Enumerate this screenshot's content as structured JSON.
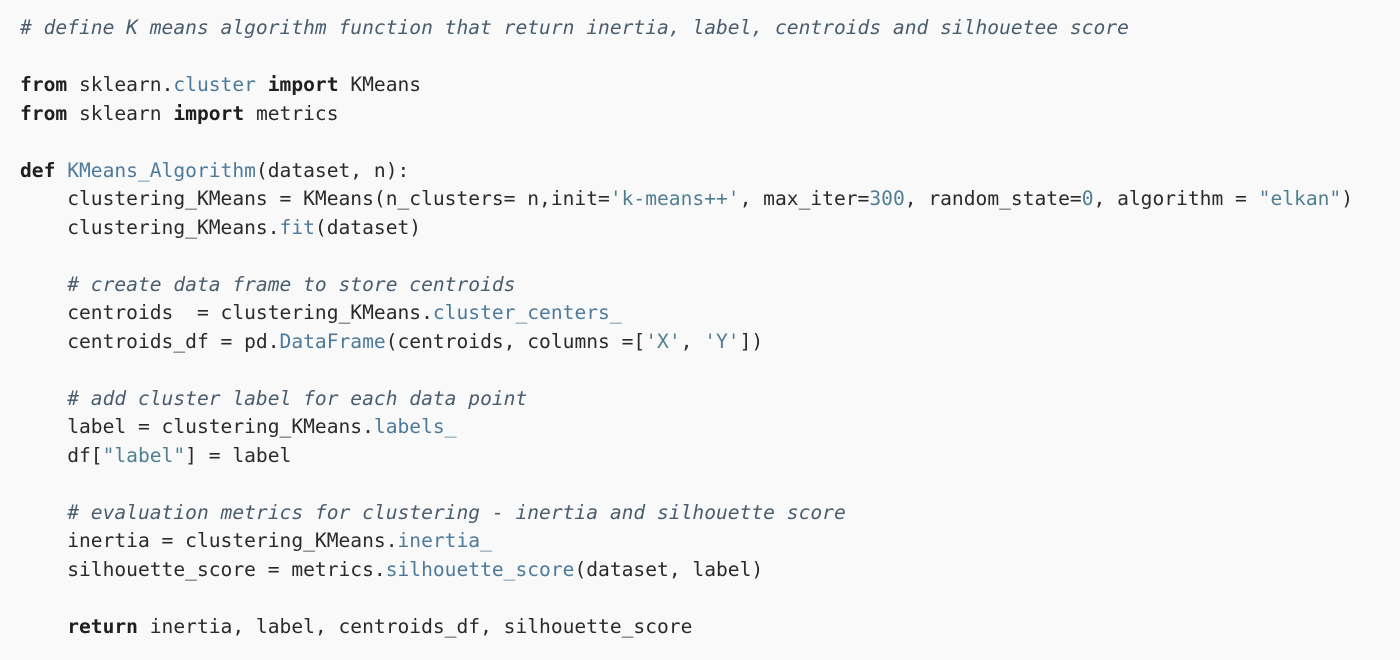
{
  "comment_header": "# define K means algorithm function that return inertia, label, centroids and silhouetee score",
  "import1": {
    "kw_from": "from",
    "module": "sklearn",
    "dot": ".",
    "submodule": "cluster",
    "kw_import": "import",
    "name": "KMeans"
  },
  "import2": {
    "kw_from": "from",
    "module": "sklearn",
    "kw_import": "import",
    "name": "metrics"
  },
  "def_line": {
    "kw_def": "def",
    "func_name": "KMeans_Algorithm",
    "params": "(dataset, n):"
  },
  "kmeans_line": {
    "lhs": "clustering_KMeans = KMeans(n_clusters= n,init=",
    "init_value": "'k-means++'",
    "mid": ", max_iter=",
    "max_iter": "300",
    "mid2": ", random_state=",
    "random_state": "0",
    "mid3": ", algorithm = ",
    "algorithm_value": "\"elkan\"",
    "end": ")"
  },
  "fit_line": {
    "obj": "clustering_KMeans.",
    "method": "fit",
    "args": "(dataset)"
  },
  "comment_centroids": "# create data frame to store centroids",
  "centroids_line": {
    "lhs": "centroids  = clustering_KMeans.",
    "attr": "cluster_centers_"
  },
  "centroids_df_line": {
    "lhs": "centroids_df = pd.",
    "func": "DataFrame",
    "mid": "(centroids, columns =[",
    "col_x": "'X'",
    "sep": ", ",
    "col_y": "'Y'",
    "end": "])"
  },
  "comment_label": "# add cluster label for each data point",
  "label_line": {
    "lhs": "label = clustering_KMeans.",
    "attr": "labels_"
  },
  "df_label_line": {
    "lhs": "df[",
    "key": "\"label\"",
    "rhs": "] = label"
  },
  "comment_metrics": "# evaluation metrics for clustering - inertia and silhouette score",
  "inertia_line": {
    "lhs": "inertia = clustering_KMeans.",
    "attr": "inertia_"
  },
  "silhouette_line": {
    "lhs": "silhouette_score = metrics.",
    "func": "silhouette_score",
    "args": "(dataset, label)"
  },
  "return_line": {
    "kw_return": "return",
    "values": " inertia, label, centroids_df, silhouette_score"
  }
}
